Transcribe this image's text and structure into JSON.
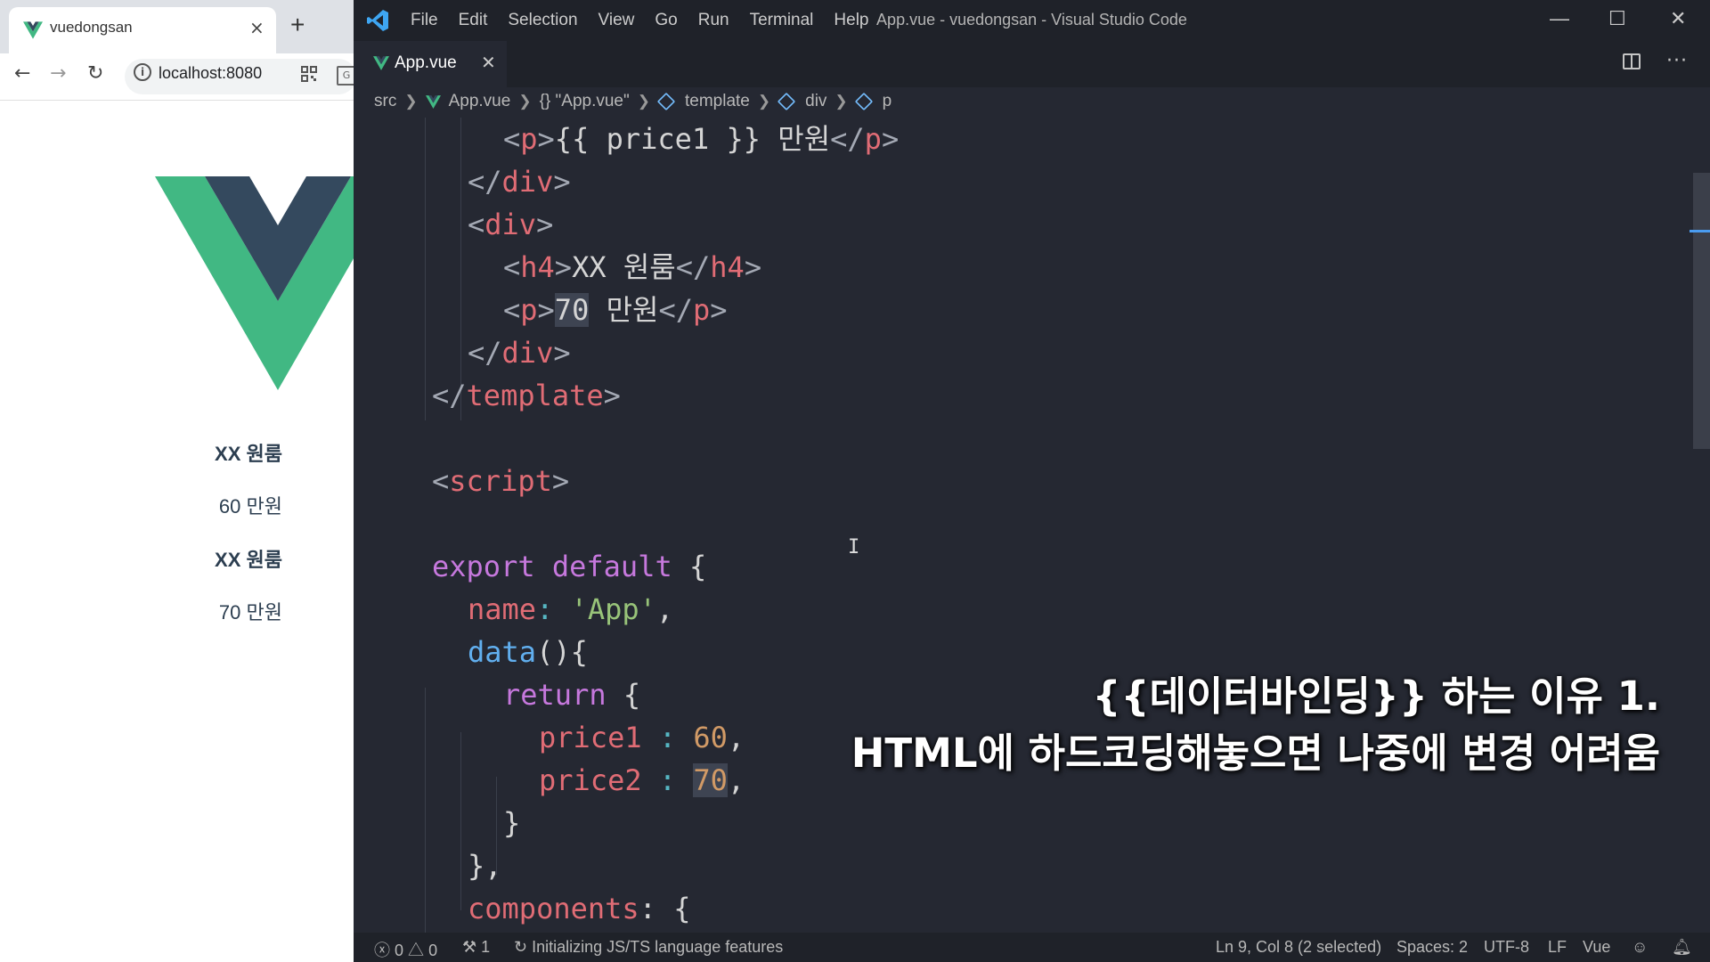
{
  "browser": {
    "tab_title": "vuedongsan",
    "tab_close": "×",
    "new_tab": "+",
    "url": "localhost:8080",
    "rendered": [
      {
        "kind": "h4",
        "text": "XX 원룸"
      },
      {
        "kind": "p",
        "text": "60 만원"
      },
      {
        "kind": "h4",
        "text": "XX 원룸"
      },
      {
        "kind": "p",
        "text": "70 만원"
      }
    ],
    "colors": {
      "vue_green": "#41b883",
      "vue_dark": "#34495e"
    }
  },
  "vscode": {
    "menu": [
      "File",
      "Edit",
      "Selection",
      "View",
      "Go",
      "Run",
      "Terminal",
      "Help"
    ],
    "window_title": "App.vue - vuedongsan - Visual Studio Code",
    "window_controls": {
      "minimize": "—",
      "maximize": "☐",
      "close": "✕"
    },
    "editor_tab": "App.vue",
    "tab_close": "✕",
    "more": "···",
    "breadcrumb": {
      "src": "src",
      "file": "App.vue",
      "object": "{} \"App.vue\"",
      "template": "template",
      "div": "div",
      "p": "p"
    },
    "code": {
      "l1": {
        "tag_open": "p",
        "expr": "{{ price1 }}",
        "text": " 만원",
        "tag_close": "p"
      },
      "l2": {
        "tag": "div"
      },
      "l3": {
        "tag": "div"
      },
      "l4": {
        "tag_open": "h4",
        "text": "XX 원룸",
        "tag_close": "h4"
      },
      "l5": {
        "tag_open": "p",
        "value": "70",
        "text": " 만원",
        "tag_close": "p"
      },
      "l6": {
        "tag": "div"
      },
      "l7": {
        "tag": "template"
      },
      "l8": {
        "tag": "script"
      },
      "l9": {
        "kw1": "export",
        "kw2": "default",
        "brace": " {"
      },
      "l10": {
        "key": "name",
        "colon": ": ",
        "value": "'App'",
        "comma": ","
      },
      "l11": {
        "fn": "data",
        "rest": "(){"
      },
      "l12": {
        "kw": "return",
        "rest": " {"
      },
      "l13": {
        "key": "price1",
        "colon": " : ",
        "value": "60",
        "comma": ","
      },
      "l14": {
        "key": "price2",
        "colon": " : ",
        "value": "70",
        "comma": ","
      },
      "l15": {
        "text": "}"
      },
      "l16": {
        "text": "},"
      },
      "l17": {
        "key": "components",
        "rest": ": {"
      }
    },
    "overlay": {
      "line1": "{{데이터바인딩}} 하는 이유 1.",
      "line2": "HTML에 하드코딩해놓으면 나중에 변경 어려움"
    },
    "status": {
      "errors": "0",
      "warnings": "0",
      "ports": "1",
      "task": "Initializing JS/TS language features",
      "position": "Ln 9, Col 8 (2 selected)",
      "spaces": "Spaces: 2",
      "encoding": "UTF-8",
      "eol": "LF",
      "language": "Vue"
    }
  }
}
